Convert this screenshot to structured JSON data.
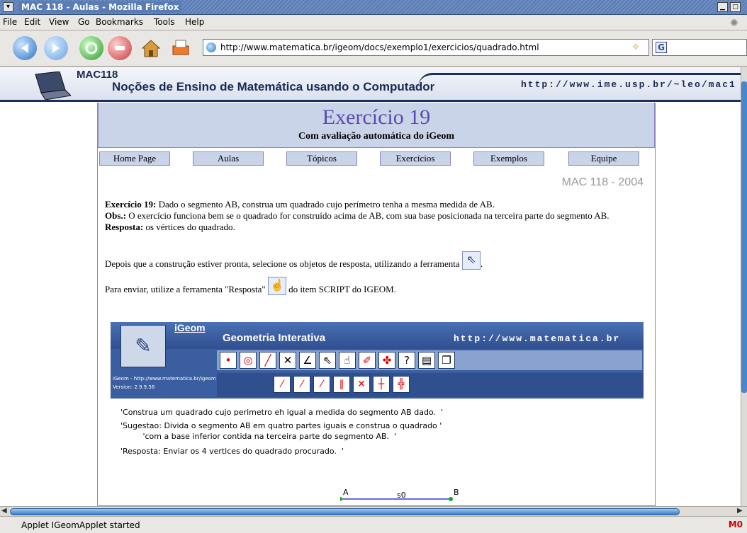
{
  "window": {
    "title": "MAC 118 - Aulas - Mozilla Firefox",
    "sysmenu_glyph": "▾",
    "min_glyph": "▁",
    "max_glyph": "□"
  },
  "menu": {
    "items": [
      "File",
      "Edit",
      "View",
      "Go",
      "Bookmarks",
      "Tools",
      "Help"
    ]
  },
  "toolbar": {
    "url": "http://www.matematica.br/igeom/docs/exemplo1/exercicios/quadrado.html",
    "search_engine": "G"
  },
  "site": {
    "mac": "MAC118",
    "subtitle": "Noções de Ensino de Matemática usando o Computador",
    "url": "http://www.ime.usp.br/~leo/mac1"
  },
  "exercise": {
    "title": "Exercício 19",
    "subtitle": "Com avaliação automática do iGeom",
    "course_tag": "MAC 118 - 2004",
    "nav": [
      "Home Page",
      "Aulas",
      "Tópicos",
      "Exercícios",
      "Exemplos",
      "Equipe"
    ],
    "p1_label": "Exercício 19:",
    "p1_text": " Dado o segmento AB, construa um quadrado cujo perímetro tenha a mesma medida de AB.",
    "p2_label": "Obs.:",
    "p2_text": " O exercício funciona bem se o quadrado for construído acima de AB, com sua base posicionada na terceira parte do segmento AB.",
    "p3_label": "Resposta:",
    "p3_text": " os vértices do quadrado.",
    "p4_text": "Depois que a construção estiver pronta, selecione os objetos de resposta, utilizando a ferramenta",
    "p4_end": ".",
    "p5_text": "Para enviar, utilize a ferramenta \"Resposta\"",
    "p5_end": " do item SCRIPT do IGEOM."
  },
  "applet": {
    "igeom": "iGeom",
    "geometria": "Geometria Interativa",
    "url": "http://www.matematica.br",
    "ver1": "iGeom - http://www.matematica.br/igeom",
    "ver2": "Version: 2.9.9.56",
    "script": [
      "'Construa um quadrado cujo perimetro eh igual a medida do segmento AB dado.  '",
      "'Sugestao: Divida o segmento AB em quatro partes iguais e construa o quadrado '",
      "         'com a base inferior contida na terceira parte do segmento AB.  '",
      "'Resposta: Enviar os 4 vertices do quadrado procurado.  '"
    ],
    "point_a": "A",
    "point_b": "B",
    "seg_label": "s0"
  },
  "status": {
    "text": "Applet IGeomApplet started",
    "mail": "M0"
  }
}
